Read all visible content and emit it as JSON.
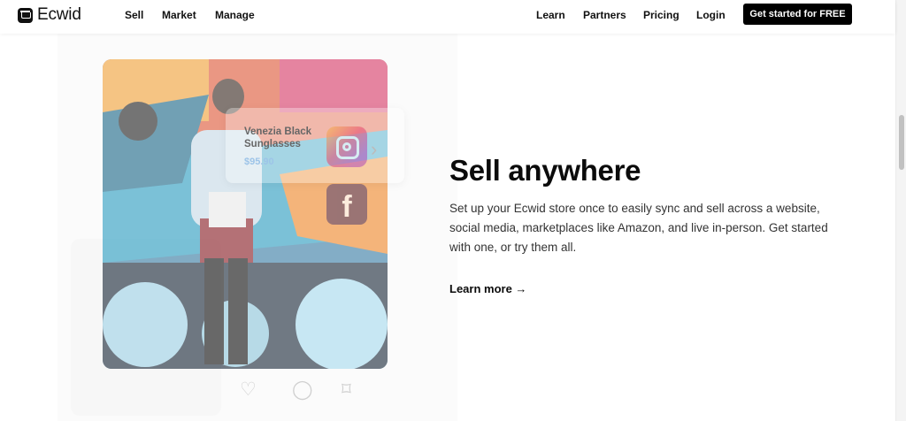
{
  "brand": {
    "name": "Ecwid",
    "logo_icon": "cart-logo-icon"
  },
  "nav": {
    "left": [
      "Sell",
      "Market",
      "Manage"
    ],
    "right": [
      "Learn",
      "Partners",
      "Pricing",
      "Login"
    ],
    "cta": "Get started for FREE"
  },
  "product": {
    "name": "Venezia Black Sunglasses",
    "price": "$95.90"
  },
  "icons": {
    "instagram": "instagram-icon",
    "facebook": "facebook-icon",
    "facebook_glyph": "f",
    "chevron": "›",
    "heart": "♡",
    "comment": "◯",
    "bookmark": "⌑"
  },
  "hero": {
    "title": "Sell anywhere",
    "body": "Set up your Ecwid store once to easily sync and sell across a website, social media, marketplaces like Amazon, and live in-person. Get started with one, or try them all.",
    "link": "Learn more →"
  },
  "colors": {
    "cta_bg": "#000000",
    "price": "#9dc4e8",
    "text": "#333333"
  }
}
